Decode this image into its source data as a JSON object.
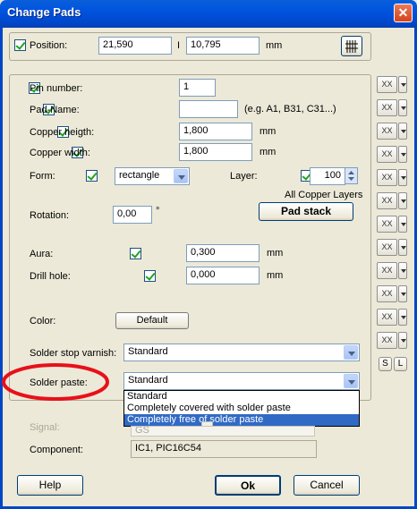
{
  "window": {
    "title": "Change Pads",
    "close": "✕"
  },
  "position": {
    "label": "Position:",
    "x": "21,590",
    "separator": "I",
    "y": "10,795",
    "unit": "mm"
  },
  "fields": {
    "pin_number": {
      "label": "Pin number:",
      "value": "1"
    },
    "pad_name": {
      "label": "Pad-Name:",
      "value": "",
      "hint": "(e.g. A1, B31, C31...)"
    },
    "copper_height": {
      "label": "Copper heigth:",
      "value": "1,800",
      "unit": "mm"
    },
    "copper_width": {
      "label": "Copper width:",
      "value": "1,800",
      "unit": "mm"
    },
    "form": {
      "label": "Form:",
      "value": "rectangle"
    },
    "layer": {
      "label": "Layer:",
      "value": "100",
      "caption": "All Copper Layers"
    },
    "pad_stack": "Pad stack",
    "rotation": {
      "label": "Rotation:",
      "value": "0,00",
      "unit": "°"
    },
    "aura": {
      "label": "Aura:",
      "value": "0,300",
      "unit": "mm"
    },
    "drill_hole": {
      "label": "Drill hole:",
      "value": "0,000",
      "unit": "mm"
    },
    "color": {
      "label": "Color:",
      "button": "Default"
    },
    "solder_stop": {
      "label": "Solder stop varnish:",
      "value": "Standard"
    },
    "solder_paste": {
      "label": "Solder paste:",
      "value": "Standard",
      "options": [
        "Standard",
        "Completely covered with solder paste",
        "Completely free of solder paste"
      ],
      "highlighted_index": 2
    },
    "signal": {
      "label": "Signal:",
      "value": "GS"
    },
    "component": {
      "label": "Component:",
      "value": "IC1, PIC16C54"
    }
  },
  "side_buttons": {
    "icon_label": "XX",
    "count": 12,
    "s_label": "S",
    "l_label": "L"
  },
  "footer": {
    "help": "Help",
    "ok": "Ok",
    "cancel": "Cancel"
  },
  "annotation": {
    "circle_color": "#e8101a"
  },
  "colors": {
    "titlebar": "#0053e0",
    "dialog_bg": "#ece9d8",
    "selection": "#316ac5"
  }
}
